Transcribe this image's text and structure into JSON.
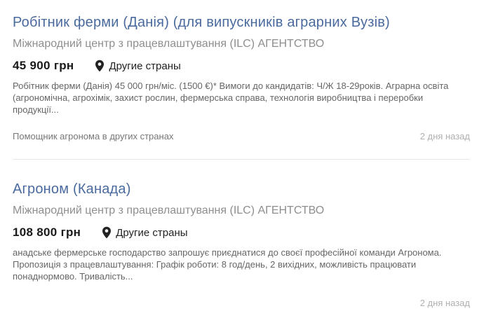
{
  "vacancies": [
    {
      "title": "Робітник ферми (Данія) (для випускників аграрних Вузів)",
      "company": "Міжнародний центр з працевлаштування (ILC) АГЕНТСТВО",
      "salary": "45 900 грн",
      "location_icon": "map-pin-icon",
      "location": "Другие страны",
      "description": "Робітник ферми (Данія) 45 000 грн/міс. (1500 €)* Вимоги до кандидатів: Ч/Ж 18-29років. Аграрна освіта (агрономічна, агрохімік, захист рослин, фермерська справа, технологія виробництва і переробки продукції...",
      "category": "Помощник агронома в других странах",
      "date": "2 дня назад"
    },
    {
      "title": "Агроном (Канада)",
      "company": "Міжнародний центр з працевлаштування (ILC) АГЕНТСТВО",
      "salary": "108 800 грн",
      "location_icon": "map-pin-icon",
      "location": "Другие страны",
      "description": "анадське фермерське господарство запрошує приєднатися до своєї професійної команди Агронома. Пропозиція з працевлаштування: Графік роботи: 8 год/день, 2 вихідних, можливість працювати понаднормово. Тривалість...",
      "category": "",
      "date": "2 дня назад"
    }
  ]
}
